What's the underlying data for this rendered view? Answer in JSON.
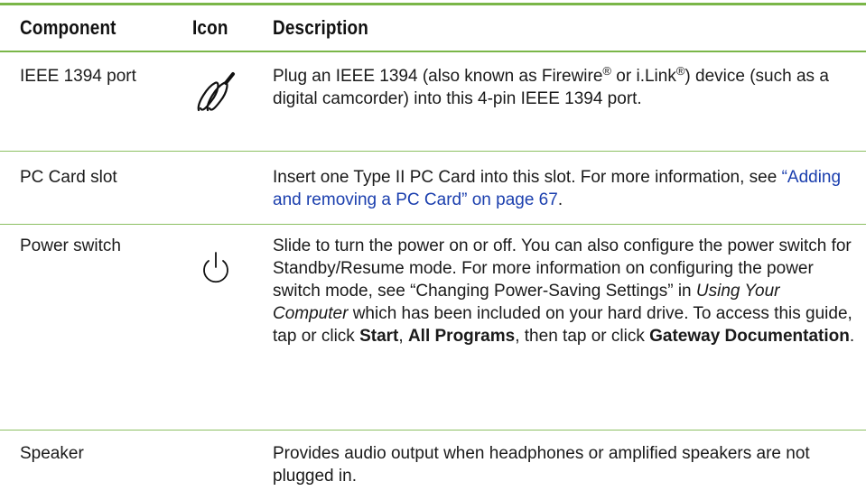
{
  "table": {
    "headers": {
      "component": "Component",
      "icon": "Icon",
      "description": "Description"
    },
    "rows": [
      {
        "component": "IEEE 1394 port",
        "icon": "firewire-cable-icon",
        "desc": {
          "p1": "Plug an IEEE 1394 (also known as Firewire",
          "sup1": "®",
          "p2": " or i.Link",
          "sup2": "®",
          "p3": ") device (such as a digital camcorder) into this 4-pin IEEE 1394 port."
        }
      },
      {
        "component": "PC Card slot",
        "icon": "",
        "desc": {
          "p1": "Insert one Type II PC Card into this slot. For more information, see ",
          "link": "“Adding and removing a PC Card” on page 67",
          "p2": "."
        }
      },
      {
        "component": "Power switch",
        "icon": "power-icon",
        "desc": {
          "p1": "Slide to turn the power on or off. You can also configure the power switch for Standby/Resume mode. For more information on configuring the power switch mode, see “Changing Power-Saving Settings” in ",
          "em": "Using Your Computer",
          "p2": " which has been included on your hard drive. To access this guide, tap or click ",
          "b1": "Start",
          "p3": ", ",
          "b2": "All Programs",
          "p4": ", then tap or click ",
          "b3": "Gateway Documentation",
          "p5": "."
        }
      },
      {
        "component": "Speaker",
        "icon": "",
        "desc": {
          "p1": "Provides audio output when headphones or amplified speakers are not plugged in."
        }
      }
    ]
  },
  "colors": {
    "rule": "#7ab648",
    "link": "#1b3fae"
  }
}
